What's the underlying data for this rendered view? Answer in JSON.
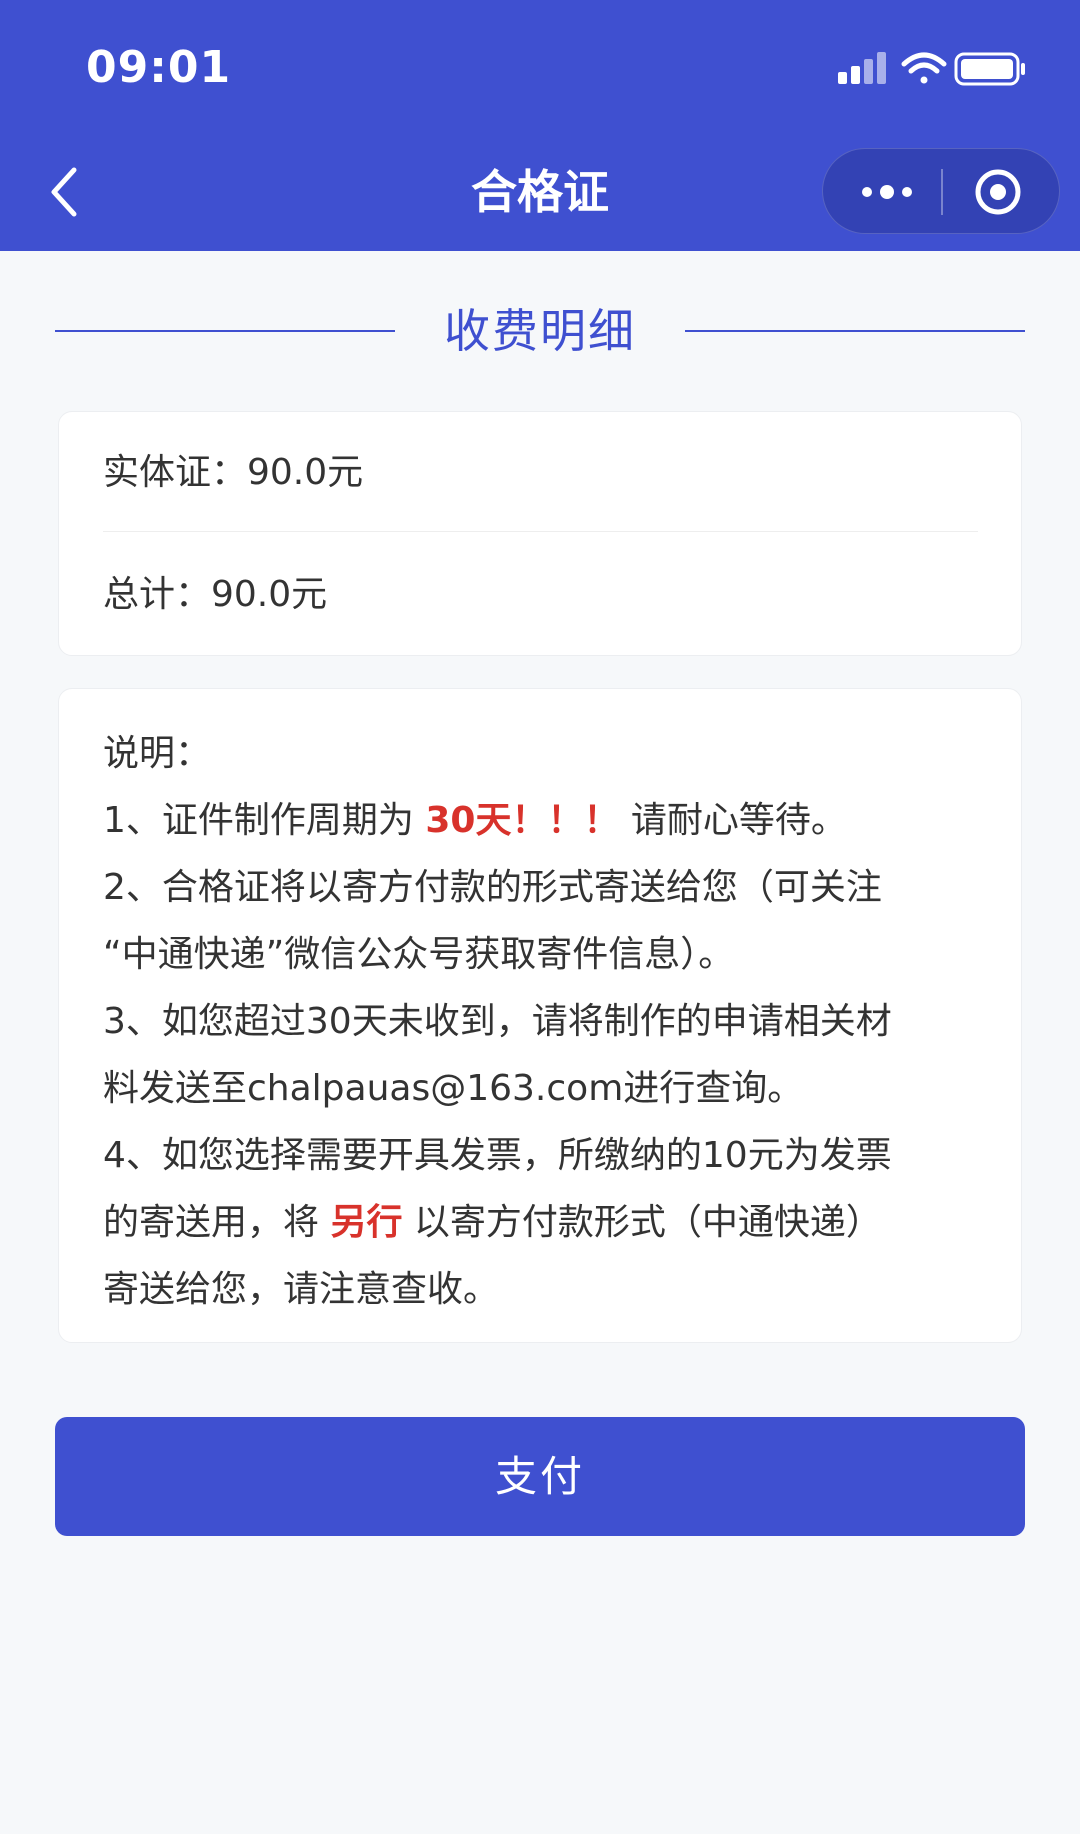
{
  "status_bar": {
    "time": "09:01"
  },
  "nav": {
    "title": "合格证",
    "icons": [
      "back-arrow-icon",
      "more-dots-icon",
      "close-target-icon"
    ]
  },
  "section": {
    "title": "收费明细"
  },
  "fees": {
    "physical_cert": "实体证：90.0元",
    "total": "总计：90.0元"
  },
  "notice": {
    "heading": "说明：",
    "line1_pre": "1、证件制作周期为 ",
    "line1_highlight": "30天！！！",
    "line1_post": " 请耐心等待。",
    "line2a": "2、合格证将以寄方付款的形式寄送给您（可关注",
    "line2b": "“中通快递”微信公众号获取寄件信息）。",
    "line3a": "3、如您超过30天未收到，请将制作的申请相关材",
    "line3b": "料发送至chalpauas@163.com进行查询。",
    "line4a": "4、如您选择需要开具发票，所缴纳的10元为发票",
    "line4b_pre": "的寄送用，将 ",
    "line4b_highlight": "另行",
    "line4b_post": " 以寄方付款形式（中通快递）",
    "line4c": "寄送给您，请注意查收。"
  },
  "pay_button": {
    "label": "支付"
  },
  "colors": {
    "primary": "#3f50d0",
    "highlight_red": "#d8322b",
    "background": "#f6f8fa"
  }
}
